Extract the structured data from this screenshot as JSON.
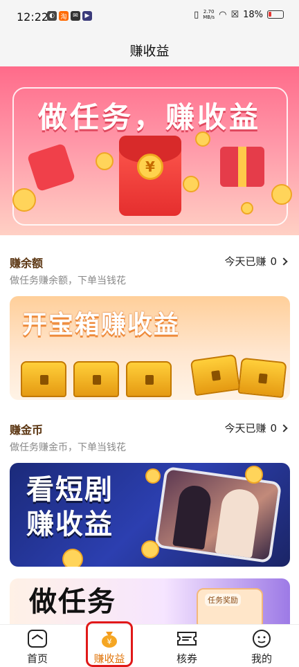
{
  "status_bar": {
    "time": "12:22",
    "net_speed_value": "2.70",
    "net_speed_unit": "MB/s",
    "battery": "18%"
  },
  "header": {
    "title": "赚收益"
  },
  "hero": {
    "title": "做任务，赚收益",
    "currency_symbol": "¥"
  },
  "section_balance": {
    "title": "赚余额",
    "earned_label": "今天已赚",
    "earned_value": "0",
    "subtitle": "做任务赚余额，下单当钱花"
  },
  "banner_chest": {
    "title": "开宝箱赚收益"
  },
  "section_coins": {
    "title": "赚金币",
    "earned_label": "今天已赚",
    "earned_value": "0",
    "subtitle": "做任务赚金币，下单当钱花"
  },
  "banner_drama": {
    "line1": "看短剧",
    "line2": "赚收益"
  },
  "banner_task": {
    "title": "做任务",
    "card_label": "任务奖励"
  },
  "tabbar": {
    "tabs": [
      {
        "label": "首页",
        "icon": "home-icon"
      },
      {
        "label": "赚收益",
        "icon": "money-bag-icon"
      },
      {
        "label": "核券",
        "icon": "coupon-icon"
      },
      {
        "label": "我的",
        "icon": "profile-icon"
      }
    ],
    "active_tab": "赚收益"
  },
  "colors": {
    "accent": "#e0740a",
    "highlight": "#e01818"
  }
}
